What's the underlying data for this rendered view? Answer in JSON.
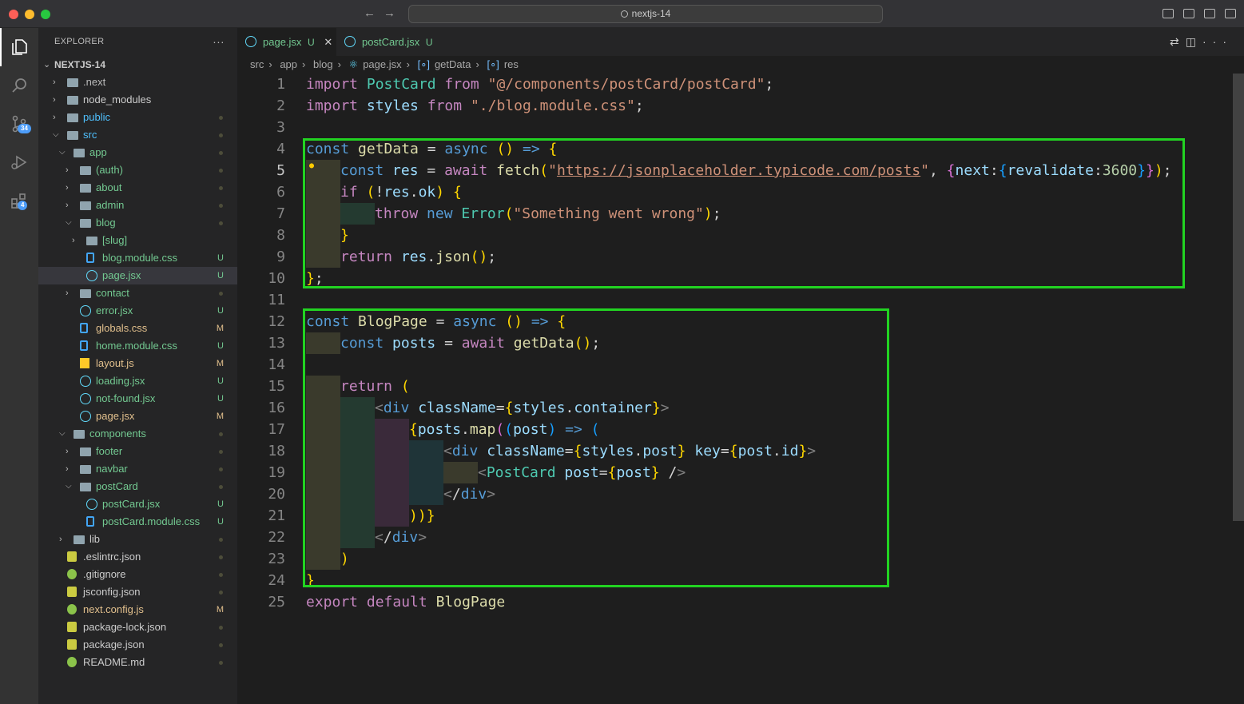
{
  "window": {
    "title": "nextjs-14"
  },
  "explorer": {
    "title": "EXPLORER",
    "root": "NEXTJS-14",
    "items": [
      {
        "name": ".next",
        "status": ""
      },
      {
        "name": "node_modules",
        "status": ""
      },
      {
        "name": "public",
        "status": ""
      },
      {
        "name": "src",
        "status": ""
      },
      {
        "name": "app",
        "status": ""
      },
      {
        "name": "(auth)",
        "status": ""
      },
      {
        "name": "about",
        "status": ""
      },
      {
        "name": "admin",
        "status": ""
      },
      {
        "name": "blog",
        "status": ""
      },
      {
        "name": "[slug]",
        "status": ""
      },
      {
        "name": "blog.module.css",
        "status": "U"
      },
      {
        "name": "page.jsx",
        "status": "U"
      },
      {
        "name": "contact",
        "status": ""
      },
      {
        "name": "error.jsx",
        "status": "U"
      },
      {
        "name": "globals.css",
        "status": "M"
      },
      {
        "name": "home.module.css",
        "status": "U"
      },
      {
        "name": "layout.js",
        "status": "M"
      },
      {
        "name": "loading.jsx",
        "status": "U"
      },
      {
        "name": "not-found.jsx",
        "status": "U"
      },
      {
        "name": "page.jsx",
        "status": "M"
      },
      {
        "name": "components",
        "status": ""
      },
      {
        "name": "footer",
        "status": ""
      },
      {
        "name": "navbar",
        "status": ""
      },
      {
        "name": "postCard",
        "status": ""
      },
      {
        "name": "postCard.jsx",
        "status": "U"
      },
      {
        "name": "postCard.module.css",
        "status": "U"
      },
      {
        "name": "lib",
        "status": ""
      },
      {
        "name": ".eslintrc.json",
        "status": ""
      },
      {
        "name": ".gitignore",
        "status": ""
      },
      {
        "name": "jsconfig.json",
        "status": ""
      },
      {
        "name": "next.config.js",
        "status": "M"
      },
      {
        "name": "package-lock.json",
        "status": ""
      },
      {
        "name": "package.json",
        "status": ""
      },
      {
        "name": "README.md",
        "status": ""
      }
    ]
  },
  "activity": {
    "scm_badge": "34",
    "ext_badge": "4"
  },
  "tabs": [
    {
      "label": "page.jsx",
      "status": "U"
    },
    {
      "label": "postCard.jsx",
      "status": "U"
    }
  ],
  "breadcrumb": [
    "src",
    "app",
    "blog",
    "page.jsx",
    "getData",
    "res"
  ],
  "code_lines": [
    "import PostCard from \"@/components/postCard/postCard\";",
    "import styles from \"./blog.module.css\";",
    "",
    "const getData = async () => {",
    "  const res = await fetch(\"https://jsonplaceholder.typicode.com/posts\", {next:{revalidate:3600}});",
    "  if (!res.ok) {",
    "    throw new Error(\"Something went wrong\");",
    "  }",
    "  return res.json();",
    "};",
    "",
    "const BlogPage = async () => {",
    "  const posts = await getData();",
    "",
    "  return (",
    "    <div className={styles.container}>",
    "      {posts.map((post) => (",
    "        <div className={styles.post} key={post.id}>",
    "          <PostCard post={post} />",
    "        </div>",
    "      ))}",
    "    </div>",
    "  )",
    "}",
    "export default BlogPage"
  ],
  "colors": {
    "highlight_box": "#22d322",
    "accent": "#4d9df9"
  }
}
